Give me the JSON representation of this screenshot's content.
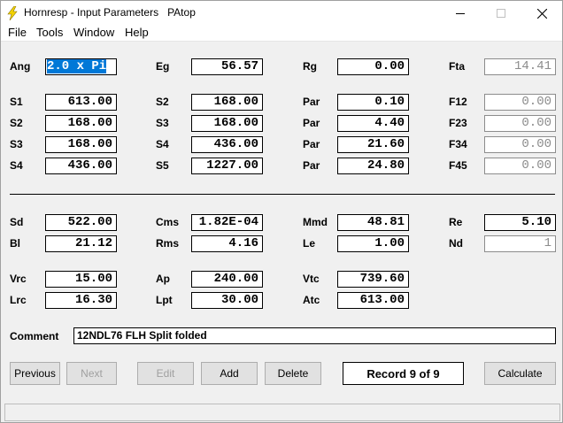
{
  "window": {
    "title": "Hornresp - Input Parameters   PAtop",
    "controls": {
      "minimize": "—",
      "maximize": "☐",
      "close": "✕"
    }
  },
  "menu": {
    "file": "File",
    "tools": "Tools",
    "window": "Window",
    "help": "Help"
  },
  "labels": {
    "ang": "Ang",
    "eg": "Eg",
    "rg": "Rg",
    "fta": "Fta",
    "s1": "S1",
    "s2": "S2",
    "s3": "S3",
    "s4": "S4",
    "s2b": "S2",
    "s3b": "S3",
    "s4b": "S4",
    "s5": "S5",
    "par1": "Par",
    "par2": "Par",
    "par3": "Par",
    "par4": "Par",
    "f12": "F12",
    "f23": "F23",
    "f34": "F34",
    "f45": "F45",
    "sd": "Sd",
    "bl": "Bl",
    "vrc": "Vrc",
    "lrc": "Lrc",
    "cms": "Cms",
    "rms": "Rms",
    "ap": "Ap",
    "lpt": "Lpt",
    "mmd": "Mmd",
    "le": "Le",
    "vtc": "Vtc",
    "atc": "Atc",
    "re": "Re",
    "nd": "Nd",
    "comment": "Comment"
  },
  "values": {
    "ang": "2.0 x Pi",
    "eg": "56.57",
    "rg": "0.00",
    "fta": "14.41",
    "s1": "613.00",
    "s2a": "168.00",
    "s3a": "168.00",
    "s4a": "436.00",
    "s2b": "168.00",
    "s3b": "168.00",
    "s4b": "436.00",
    "s5": "1227.00",
    "par1": "0.10",
    "par2": "4.40",
    "par3": "21.60",
    "par4": "24.80",
    "f12": "0.00",
    "f23": "0.00",
    "f34": "0.00",
    "f45": "0.00",
    "sd": "522.00",
    "bl": "21.12",
    "vrc": "15.00",
    "lrc": "16.30",
    "cms": "1.82E-04",
    "rms": "4.16",
    "ap": "240.00",
    "lpt": "30.00",
    "mmd": "48.81",
    "le": "1.00",
    "vtc": "739.60",
    "atc": "613.00",
    "re": "5.10",
    "nd": "1",
    "comment": "12NDL76 FLH Split folded"
  },
  "buttons": {
    "previous": "Previous",
    "next": "Next",
    "edit": "Edit",
    "add": "Add",
    "delete": "Delete",
    "calculate": "Calculate"
  },
  "record": "Record 9 of 9",
  "colors": {
    "selection": "#0078d7",
    "disabled_text": "#8c8c8c",
    "app_icon": "#f5d400"
  },
  "icons": {
    "app": "lightning-bolt-icon"
  }
}
